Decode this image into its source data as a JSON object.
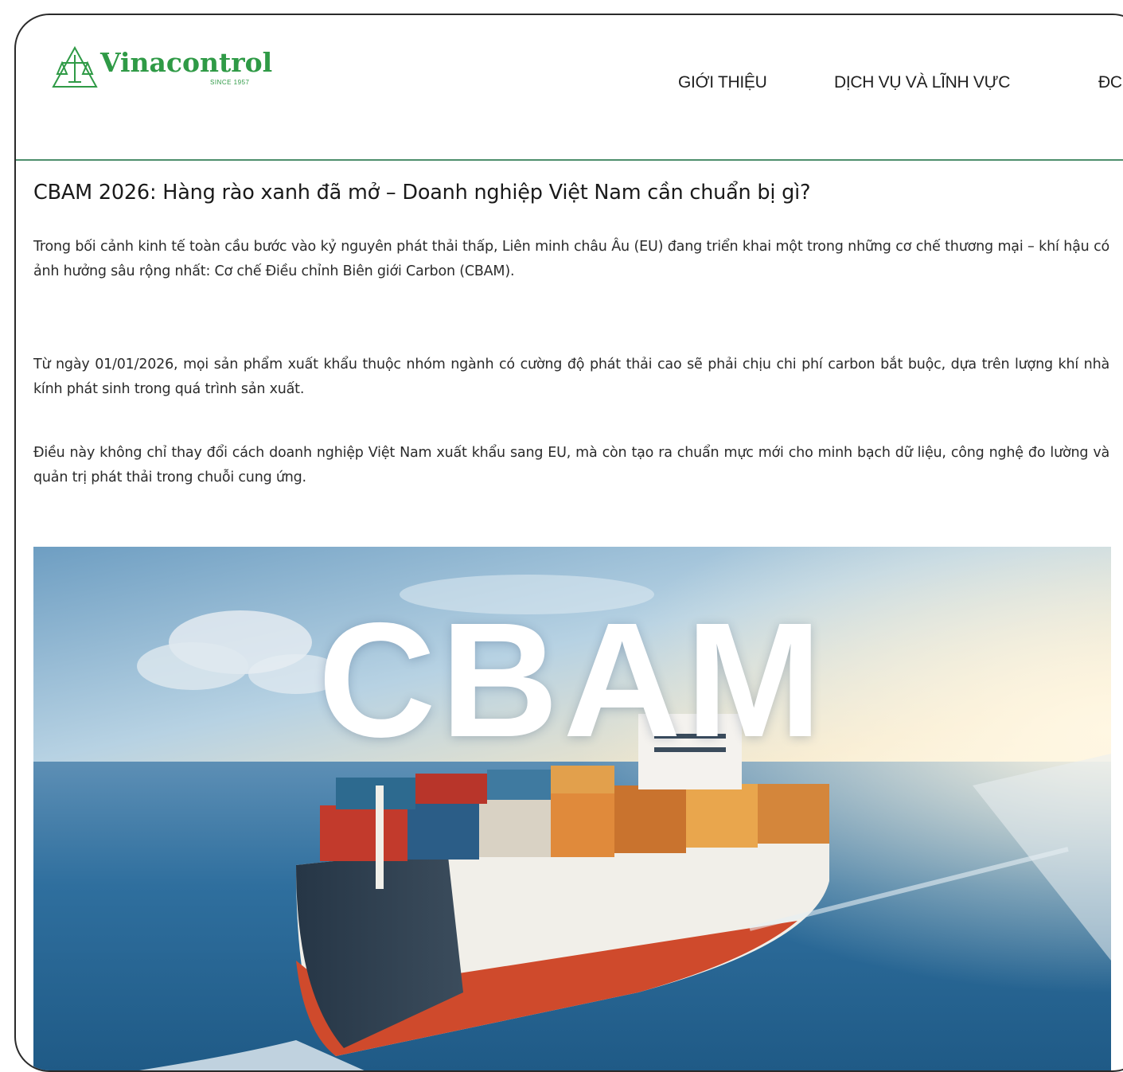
{
  "header": {
    "logo": {
      "name": "Vinacontrol",
      "tagline": "SINCE 1957",
      "brand_color": "#2f9a46"
    },
    "nav": [
      {
        "label": "GIỚI THIỆU"
      },
      {
        "label": "DỊCH VỤ VÀ LĨNH VỰC"
      },
      {
        "label": "ĐC"
      }
    ]
  },
  "article": {
    "title": "CBAM 2026: Hàng rào xanh đã mở – Doanh nghiệp Việt Nam cần chuẩn bị gì?",
    "paragraphs": [
      "Trong bối cảnh kinh tế toàn cầu bước vào kỷ nguyên phát thải thấp, Liên minh châu Âu (EU) đang triển khai một trong những cơ chế thương mại – khí hậu có ảnh hưởng sâu rộng nhất: Cơ chế Điều chỉnh Biên giới Carbon (CBAM).",
      "Từ ngày 01/01/2026, mọi sản phẩm xuất khẩu thuộc nhóm ngành có cường độ phát thải cao sẽ phải chịu chi phí carbon bắt buộc, dựa trên lượng khí nhà kính phát sinh trong quá trình sản xuất.",
      "Điều này không chỉ thay đổi cách doanh nghiệp Việt Nam xuất khẩu sang EU, mà còn tạo ra chuẩn mực mới cho minh bạch dữ liệu, công nghệ đo lường và quản trị phát thải trong chuỗi cung ứng."
    ],
    "hero_image": {
      "overlay_text": "CBAM",
      "icon": "container-ship-image"
    }
  },
  "colors": {
    "header_divider": "#4e8f6d",
    "text": "#2b2b2b",
    "sea": "#2f6f9e",
    "sky": "#9cc3dc"
  }
}
